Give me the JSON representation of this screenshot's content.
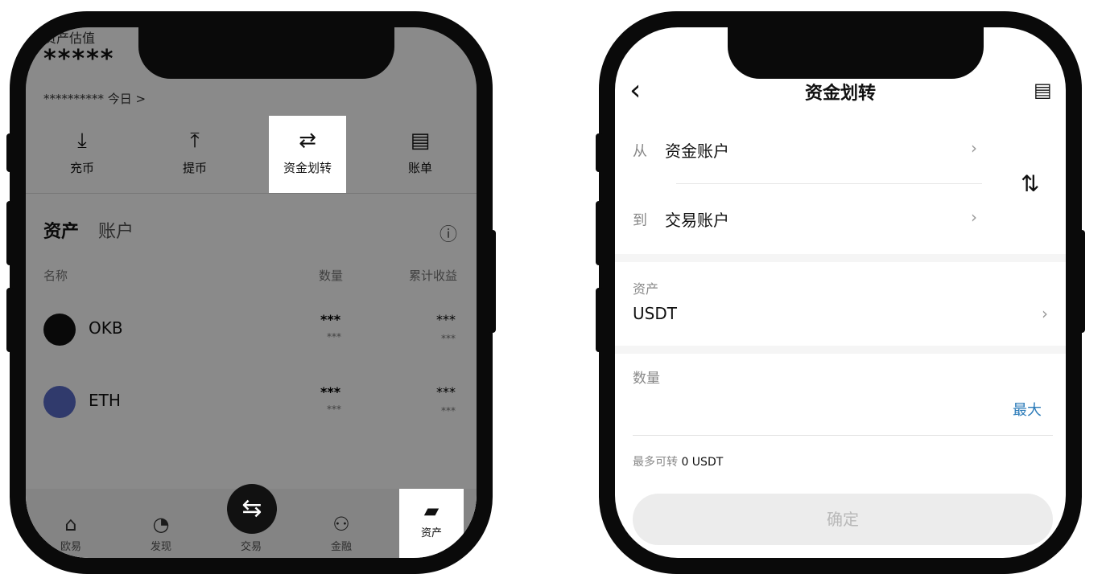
{
  "left": {
    "header": {
      "label": "资产估值",
      "balance": "*****",
      "today": "********** 今日 >"
    },
    "actions": [
      {
        "label": "充币",
        "icon": "deposit-icon",
        "glyph": "⤓"
      },
      {
        "label": "提币",
        "icon": "withdraw-icon",
        "glyph": "⤒"
      },
      {
        "label": "资金划转",
        "icon": "transfer-icon",
        "glyph": "⇄"
      },
      {
        "label": "账单",
        "icon": "bill-icon",
        "glyph": "▤"
      }
    ],
    "tabs": {
      "assets": "资产",
      "account": "账户",
      "info_glyph": "ⓘ"
    },
    "columns": {
      "name": "名称",
      "qty": "数量",
      "pnl": "累计收益"
    },
    "rows": [
      {
        "coin": "OKB",
        "qty": "***",
        "qty_sub": "***",
        "pnl": "***",
        "pnl_sub": "***",
        "color": "#111111"
      },
      {
        "coin": "ETH",
        "qty": "***",
        "qty_sub": "***",
        "pnl": "***",
        "pnl_sub": "***",
        "color": "#5a6bc8"
      }
    ],
    "nav": [
      {
        "label": "欧易",
        "icon": "home-icon",
        "glyph": "⌂"
      },
      {
        "label": "发现",
        "icon": "discover-icon",
        "glyph": "◔"
      },
      {
        "label": "交易",
        "icon": "trade-icon",
        "glyph": "⇆"
      },
      {
        "label": "金融",
        "icon": "finance-icon",
        "glyph": "⚇"
      },
      {
        "label": "资产",
        "icon": "wallet-icon",
        "glyph": "▰"
      }
    ]
  },
  "right": {
    "title": "资金划转",
    "back_glyph": "‹",
    "record_glyph": "▤",
    "from": {
      "prefix": "从",
      "value": "资金账户",
      "chevron": "›"
    },
    "to": {
      "prefix": "到",
      "value": "交易账户",
      "chevron": "›"
    },
    "swap_glyph": "⇅",
    "asset": {
      "label": "资产",
      "value": "USDT",
      "chevron": "›"
    },
    "amount": {
      "label": "数量",
      "max": "最大",
      "max_color": "#2a7ab8"
    },
    "available": {
      "prefix": "最多可转",
      "value": "0 USDT"
    },
    "confirm": "确定"
  }
}
